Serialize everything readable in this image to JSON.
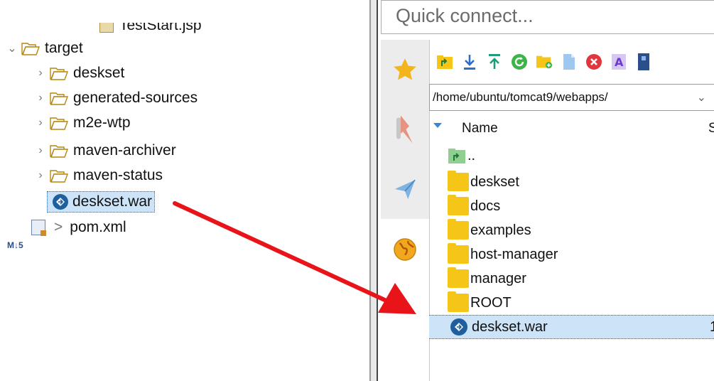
{
  "explorer": {
    "partial_top_item": "TestStart.jsp",
    "items": [
      {
        "label": "target",
        "expanded": true,
        "type": "folder"
      },
      {
        "label": "deskset",
        "type": "folder"
      },
      {
        "label": "generated-sources",
        "type": "folder"
      },
      {
        "label": "m2e-wtp",
        "type": "folder"
      },
      {
        "label": "maven-archiver",
        "type": "folder"
      },
      {
        "label": "maven-status",
        "type": "folder"
      },
      {
        "label": "deskset.war",
        "type": "war",
        "selected": true
      },
      {
        "label": "pom.xml",
        "type": "xml",
        "prefix": ">"
      }
    ],
    "partial_bottom_badge": "M↓5"
  },
  "ftp": {
    "quick_connect": "Quick connect...",
    "path": "/home/ubuntu/tomcat9/webapps/",
    "columns": {
      "name": "Name",
      "size": "S"
    },
    "files": [
      {
        "name": "..",
        "type": "up"
      },
      {
        "name": "deskset",
        "type": "folder"
      },
      {
        "name": "docs",
        "type": "folder"
      },
      {
        "name": "examples",
        "type": "folder"
      },
      {
        "name": "host-manager",
        "type": "folder"
      },
      {
        "name": "manager",
        "type": "folder"
      },
      {
        "name": "ROOT",
        "type": "folder"
      },
      {
        "name": "deskset.war",
        "type": "war",
        "size": "1",
        "selected": true
      }
    ],
    "side_tabs": [
      "star-icon",
      "pin-icon",
      "paper-plane-icon",
      "globe-icon",
      "blank-tab"
    ],
    "toolbar_icons": [
      "parent-folder-icon",
      "download-icon",
      "upload-icon",
      "refresh-icon",
      "new-folder-icon",
      "new-file-icon",
      "delete-icon",
      "rename-icon",
      "properties-icon"
    ]
  },
  "colors": {
    "selection": "#cde3f7",
    "arrow": "#e8141a",
    "folder": "#f5c518"
  }
}
